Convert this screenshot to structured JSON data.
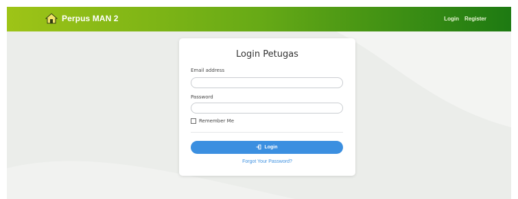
{
  "navbar": {
    "brand": "Perpus MAN 2",
    "brand_icon": "house-logo-icon",
    "links": {
      "login": "Login",
      "register": "Register"
    }
  },
  "card": {
    "title": "Login Petugas",
    "email_label": "Email address",
    "email_value": "",
    "password_label": "Password",
    "password_value": "",
    "remember_label": "Remember Me",
    "remember_checked": false,
    "login_button": "Login",
    "login_icon": "sign-in-icon",
    "forgot_link": "Forgot Your Password?"
  },
  "colors": {
    "navbar_start": "#9ec417",
    "navbar_end": "#1d7a12",
    "primary": "#3b8fe0",
    "background": "#ebedea"
  }
}
